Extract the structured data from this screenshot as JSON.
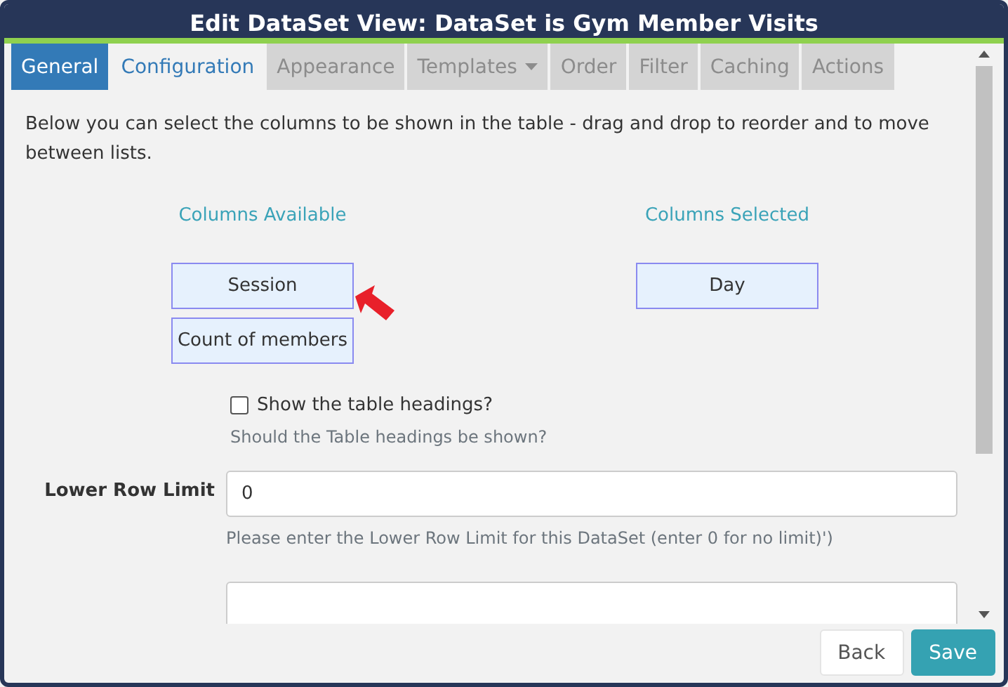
{
  "window": {
    "title": "Edit DataSet View: DataSet is Gym Member Visits"
  },
  "tabs": [
    {
      "label": "General",
      "selected": true,
      "disabled": false,
      "dropdown": false
    },
    {
      "label": "Configuration",
      "selected": false,
      "disabled": false,
      "dropdown": false
    },
    {
      "label": "Appearance",
      "selected": false,
      "disabled": true,
      "dropdown": false
    },
    {
      "label": "Templates",
      "selected": false,
      "disabled": true,
      "dropdown": true
    },
    {
      "label": "Order",
      "selected": false,
      "disabled": true,
      "dropdown": false
    },
    {
      "label": "Filter",
      "selected": false,
      "disabled": true,
      "dropdown": false
    },
    {
      "label": "Caching",
      "selected": false,
      "disabled": true,
      "dropdown": false
    },
    {
      "label": "Actions",
      "selected": false,
      "disabled": true,
      "dropdown": false
    }
  ],
  "intro": "Below you can select the columns to be shown in the table - drag and drop to reorder and to move between lists.",
  "columns_available": {
    "heading": "Columns Available",
    "items": [
      "Session",
      "Count of members"
    ]
  },
  "columns_selected": {
    "heading": "Columns Selected",
    "items": [
      "Day"
    ]
  },
  "show_headings": {
    "label": "Show the table headings?",
    "checked": false,
    "help": "Should the Table headings be shown?"
  },
  "lower_row_limit": {
    "label": "Lower Row Limit",
    "value": "0",
    "help": "Please enter the Lower Row Limit for this DataSet (enter 0 for no limit)')"
  },
  "buttons": [
    {
      "label": "Back",
      "kind": "secondary"
    },
    {
      "label": "Save",
      "kind": "primary"
    }
  ]
}
